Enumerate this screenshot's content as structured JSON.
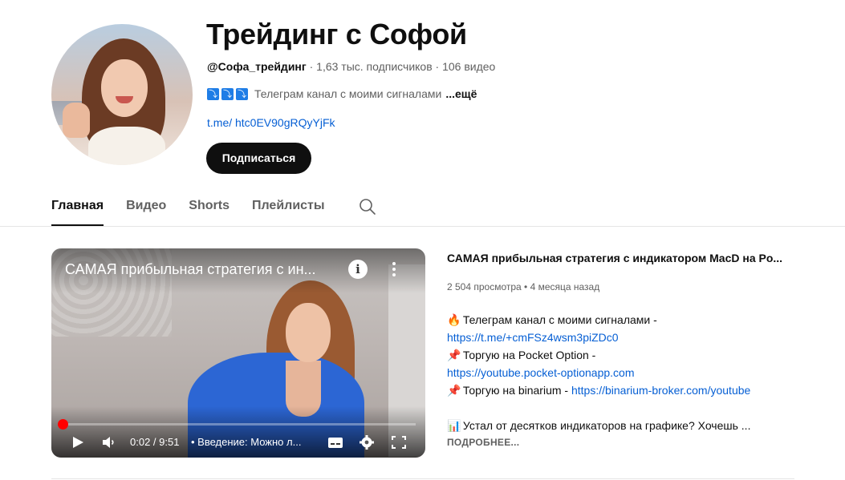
{
  "channel": {
    "title": "Трейдинг с Софой",
    "handle": "@Софа_трейдинг",
    "stats": " · 1,63 тыс. подписчиков · 106 видео",
    "description_arrows": [
      "⤵",
      "⤵",
      "⤵"
    ],
    "description": "Телеграм канал с моими сигналами",
    "description_more": "...ещё",
    "link": "t.me/ htc0EV90gRQyYjFk",
    "subscribe_label": "Подписаться"
  },
  "tabs": [
    {
      "label": "Главная",
      "active": true
    },
    {
      "label": "Видео",
      "active": false
    },
    {
      "label": "Shorts",
      "active": false
    },
    {
      "label": "Плейлисты",
      "active": false
    }
  ],
  "player": {
    "overlay_title": "САМАЯ прибыльная стратегия с ин...",
    "time": "0:02 / 9:51",
    "chapter": "• Введение: Можно л...",
    "progress_fraction": 0.0034
  },
  "video": {
    "title": "САМАЯ прибыльная стратегия с индикатором MacD на Po...",
    "stats": "2 504 просмотра • 4 месяца назад",
    "desc": [
      {
        "emoji": "🔥",
        "text": " Телеграм канал с моими сигналами -"
      },
      {
        "link": "https://t.me/+cmFSz4wsm3piZDc0"
      },
      {
        "emoji": "📌",
        "text": " Торгую на Pocket Option -"
      },
      {
        "link": "https://youtube.pocket-optionapp.com"
      },
      {
        "emoji": "📌",
        "text": " Торгую на binarium - ",
        "link": "https://binarium-broker.com/youtube"
      },
      {
        "text": ""
      },
      {
        "emoji": "📊",
        "text": " Устал от десятков индикаторов на графике? Хочешь ..."
      }
    ],
    "more_label": "ПОДРОБНЕЕ..."
  },
  "colors": {
    "link": "#065fd4",
    "progress": "#ff0000",
    "subscribe_bg": "#0f0f0f",
    "arrow_box": "#1f7de6"
  }
}
